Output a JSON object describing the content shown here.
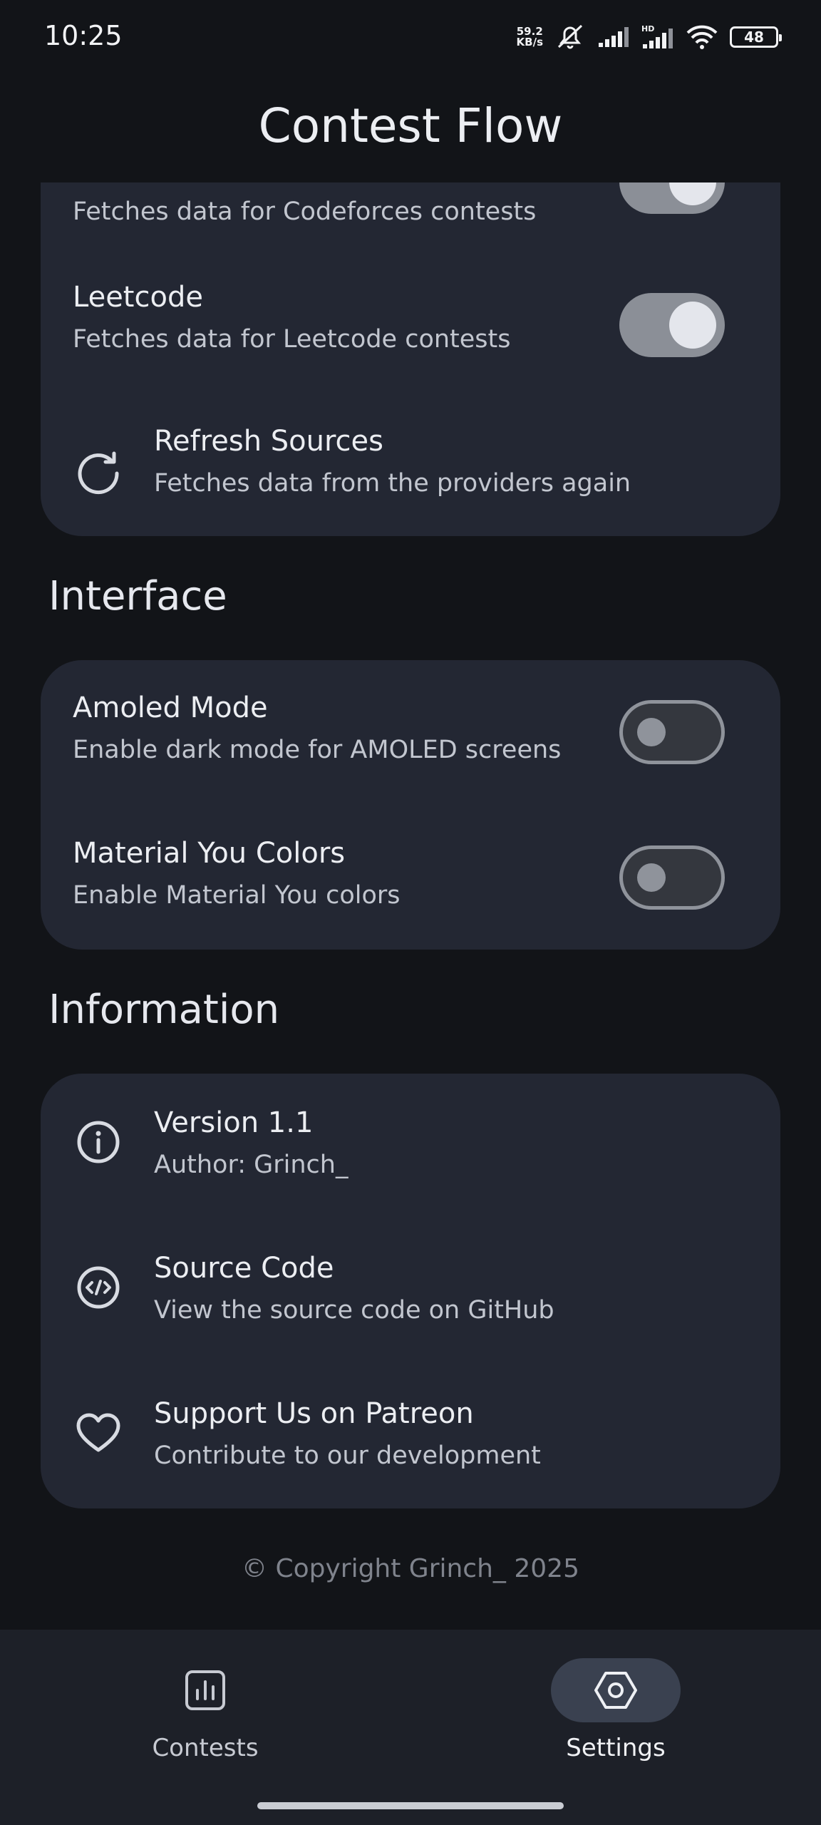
{
  "status_bar": {
    "time": "10:25",
    "net_speed_value": "59.2",
    "net_speed_unit": "KB/s",
    "battery": "48",
    "icons": [
      "bell-off-icon",
      "signal-icon",
      "signal-hd-icon",
      "wifi-icon",
      "battery-icon"
    ]
  },
  "app": {
    "title": "Contest Flow"
  },
  "sources": {
    "codeforces": {
      "subtitle": "Fetches data for Codeforces contests",
      "enabled": true
    },
    "leetcode": {
      "title": "Leetcode",
      "subtitle": "Fetches data for Leetcode contests",
      "enabled": true
    },
    "refresh": {
      "title": "Refresh Sources",
      "subtitle": "Fetches data from the providers again",
      "icon": "refresh-icon"
    }
  },
  "interface": {
    "header": "Interface",
    "amoled": {
      "title": "Amoled Mode",
      "subtitle": "Enable dark mode for AMOLED screens",
      "enabled": false
    },
    "material_you": {
      "title": "Material You Colors",
      "subtitle": "Enable Material You colors",
      "enabled": false
    }
  },
  "information": {
    "header": "Information",
    "version": {
      "title": "Version 1.1",
      "subtitle": "Author: Grinch_",
      "icon": "info-icon"
    },
    "source_code": {
      "title": "Source Code",
      "subtitle": "View the source code on GitHub",
      "icon": "code-icon"
    },
    "patreon": {
      "title": "Support Us on Patreon",
      "subtitle": "Contribute to our development",
      "icon": "heart-icon"
    }
  },
  "footer": {
    "copyright": "© Copyright Grinch_ 2025"
  },
  "bottom_nav": {
    "contests": {
      "label": "Contests",
      "icon": "bar-chart-icon"
    },
    "settings": {
      "label": "Settings",
      "icon": "settings-icon",
      "active": true
    }
  },
  "colors": {
    "background": "#121418",
    "card": "#232733",
    "nav_background": "#1d2028",
    "active_pill": "#3a4150"
  }
}
